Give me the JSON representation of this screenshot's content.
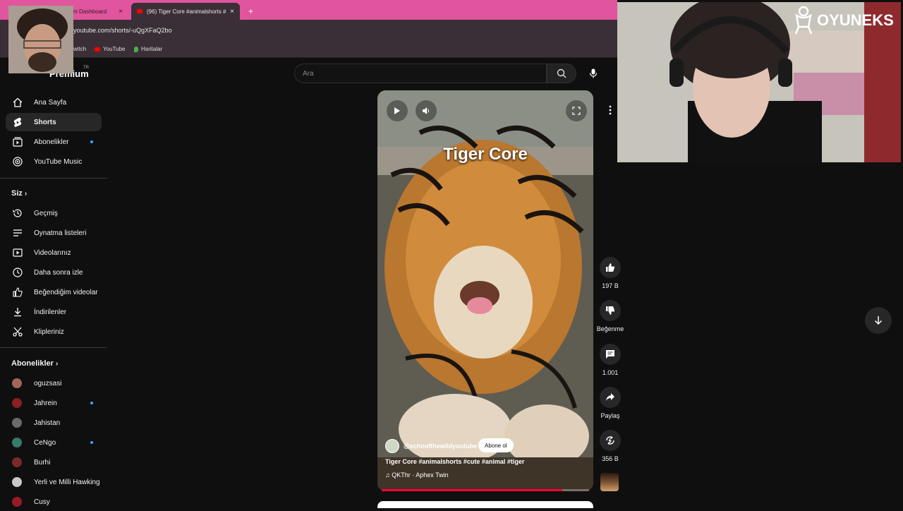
{
  "browser": {
    "tabs": [
      {
        "label": "Stream Dashboard",
        "close": "×"
      },
      {
        "label": "(96) Tiger Core #animalshorts #",
        "close": "×"
      }
    ],
    "new_tab": "+",
    "url": "youtube.com/shorts/-uQgXFaQ2bo",
    "bookmarks": [
      "witch",
      "YouTube",
      "Haritalar"
    ]
  },
  "header": {
    "logo": "Premium",
    "region": "TR",
    "search_placeholder": "Ara"
  },
  "sidebar": {
    "main": [
      {
        "label": "Ana Sayfa",
        "icon": "home-icon"
      },
      {
        "label": "Shorts",
        "icon": "shorts-icon"
      },
      {
        "label": "Abonelikler",
        "icon": "subscriptions-icon"
      },
      {
        "label": "YouTube Music",
        "icon": "music-icon"
      }
    ],
    "you_title": "Siz",
    "you": [
      {
        "label": "Geçmiş",
        "icon": "history-icon"
      },
      {
        "label": "Oynatma listeleri",
        "icon": "playlist-icon"
      },
      {
        "label": "Videolarınız",
        "icon": "video-icon"
      },
      {
        "label": "Daha sonra izle",
        "icon": "clock-icon"
      },
      {
        "label": "Beğendiğim videolar",
        "icon": "thumbs-up-icon"
      },
      {
        "label": "İndirilenler",
        "icon": "download-icon"
      },
      {
        "label": "Klipleriniz",
        "icon": "scissors-icon"
      }
    ],
    "subs_title": "Abonelikler",
    "subscriptions": [
      {
        "label": "oguzsasi",
        "color": "#a0665a",
        "dot": false
      },
      {
        "label": "Jahrein",
        "color": "#8a1f24",
        "dot": true
      },
      {
        "label": "Jahistan",
        "color": "#6a6a6a",
        "dot": false
      },
      {
        "label": "CeNgo",
        "color": "#3a7a6a",
        "dot": true
      },
      {
        "label": "Burhi",
        "color": "#7a2a2a",
        "dot": false
      },
      {
        "label": "Yerli ve Milli Hawking",
        "color": "#c8c8c8",
        "dot": false
      },
      {
        "label": "Cusy",
        "color": "#9a1a2a",
        "dot": false
      }
    ]
  },
  "short": {
    "title": "Tiger Core",
    "channel": "@echoofthewildyoutube",
    "subscribe": "Abone ol",
    "caption": "Tiger Core #animalshorts #cute #animal #tiger",
    "music": "QKThr · Aphex Twin",
    "progress": 0.87
  },
  "actions": {
    "like_count": "197 B",
    "dislike_label": "Beğenme",
    "comments_count": "1.001",
    "share_label": "Paylaş",
    "remix_count": "356 B"
  },
  "overlay": {
    "brand": "OYUNEKS"
  }
}
